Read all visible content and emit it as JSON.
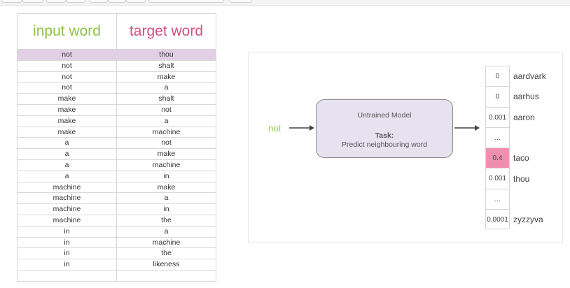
{
  "table": {
    "headers": {
      "input": "input word",
      "target": "target word"
    },
    "rows": [
      [
        "not",
        "thou"
      ],
      [
        "not",
        "shalt"
      ],
      [
        "not",
        "make"
      ],
      [
        "not",
        "a"
      ],
      [
        "make",
        "shalt"
      ],
      [
        "make",
        "not"
      ],
      [
        "make",
        "a"
      ],
      [
        "make",
        "machine"
      ],
      [
        "a",
        "not"
      ],
      [
        "a",
        "make"
      ],
      [
        "a",
        "machine"
      ],
      [
        "a",
        "in"
      ],
      [
        "machine",
        "make"
      ],
      [
        "machine",
        "a"
      ],
      [
        "machine",
        "in"
      ],
      [
        "machine",
        "the"
      ],
      [
        "in",
        "a"
      ],
      [
        "in",
        "machine"
      ],
      [
        "in",
        "the"
      ],
      [
        "in",
        "likeness"
      ],
      [
        "",
        ""
      ]
    ]
  },
  "diagram": {
    "input_word": "not",
    "model": {
      "title": "Untrained Model",
      "task_label": "Task:",
      "task_desc": "Predict neighbouring word"
    },
    "outputs": [
      {
        "value": "0",
        "word": "aardvark"
      },
      {
        "value": "0",
        "word": "aarhus"
      },
      {
        "value": "0.001",
        "word": "aaron"
      },
      {
        "value": "...",
        "word": ""
      },
      {
        "value": "0.4",
        "word": "taco",
        "highlight": true
      },
      {
        "value": "0.001",
        "word": "thou"
      },
      {
        "value": "...",
        "word": ""
      },
      {
        "value": "0.0001",
        "word": "zyzzyva"
      }
    ],
    "colors": {
      "input_header": "#8fc14a",
      "target_header": "#d64f80",
      "highlight_row": "#e2cfe6",
      "model_fill": "#e6e2f0",
      "highlight_output": "#ef8fae"
    }
  }
}
